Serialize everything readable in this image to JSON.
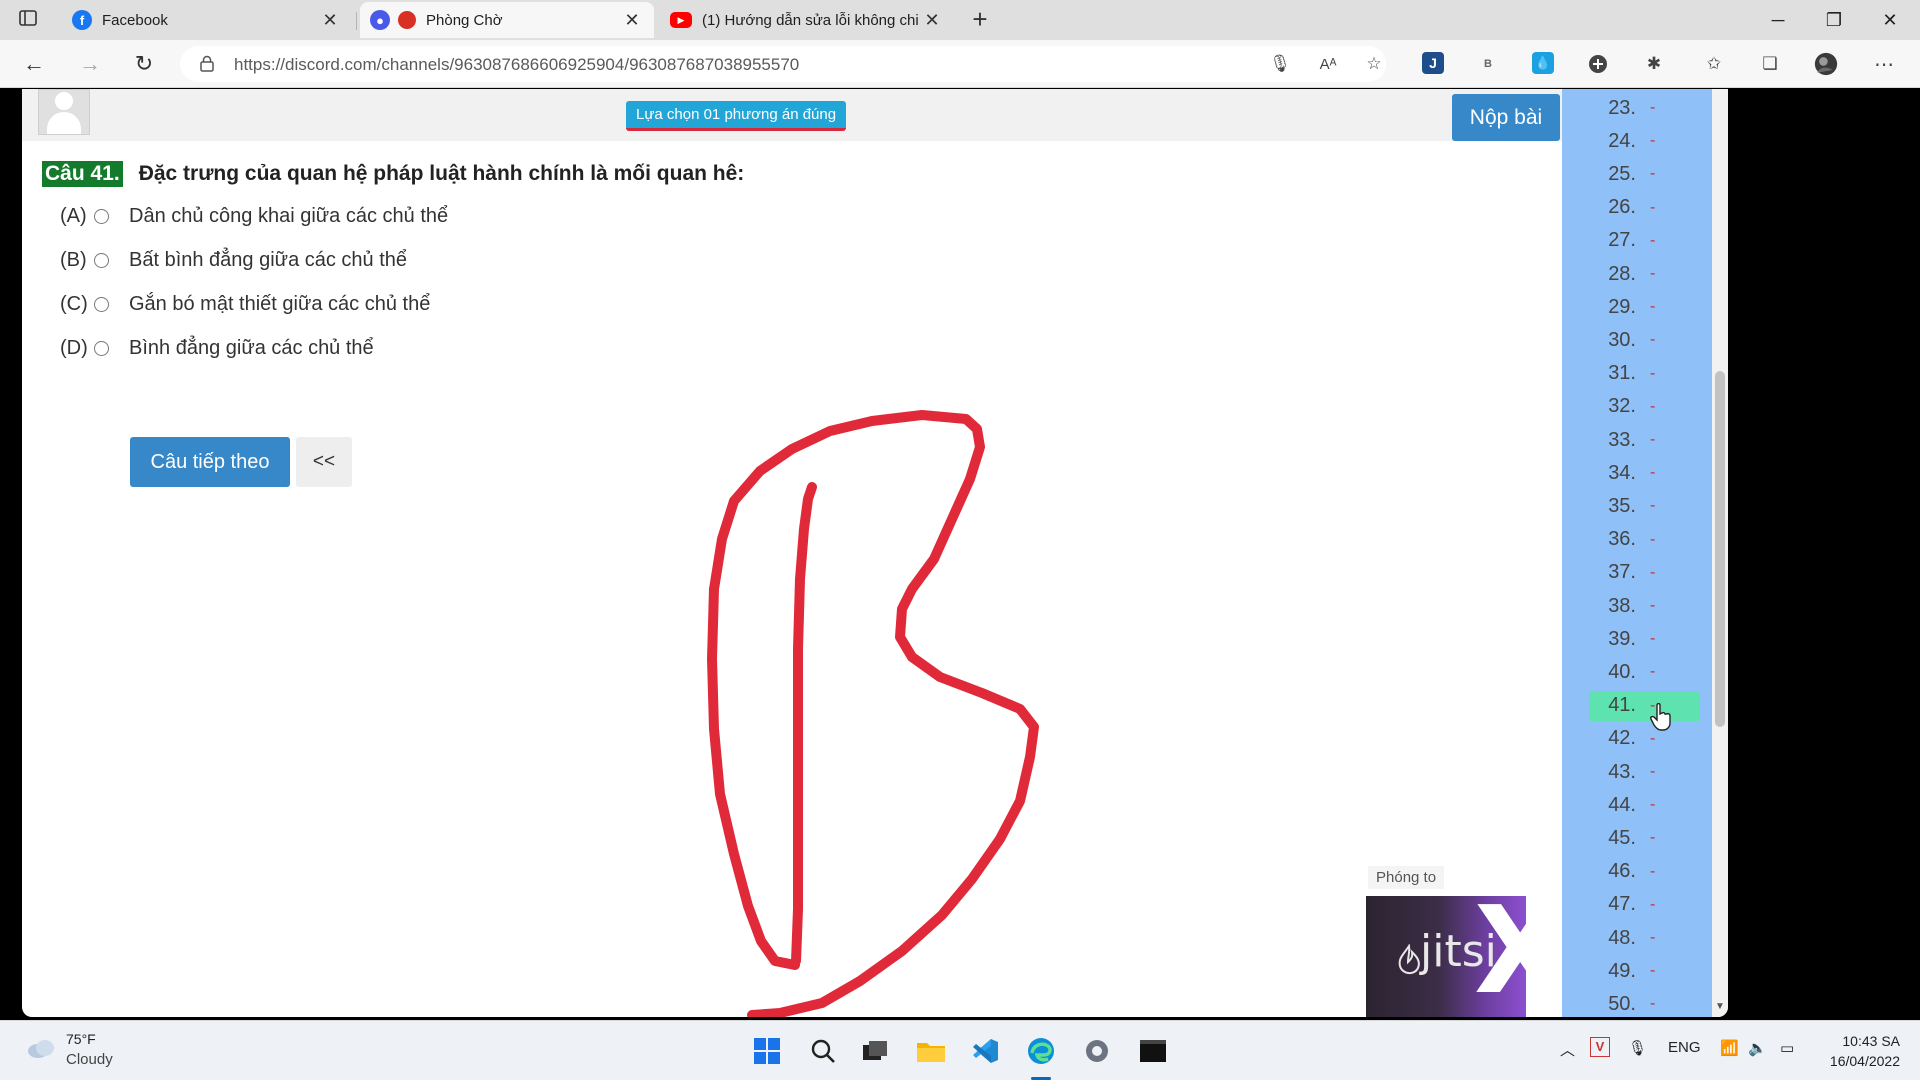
{
  "browser": {
    "tabs": [
      {
        "title": "Facebook",
        "icon": "facebook-icon",
        "color": "#1877f2",
        "active": false
      },
      {
        "title": "Phòng Chờ",
        "icon": "record-icon",
        "color": "#d93025",
        "active": true
      },
      {
        "title": "(1) Hướng dẫn sửa lỗi không chi",
        "icon": "youtube-icon",
        "color": "#ff0000",
        "active": false
      }
    ],
    "url": "https://discord.com/channels/963087686606925904/963087687038955570",
    "profile_ext_label": "B"
  },
  "exam": {
    "instruction": "Lựa chọn 01 phương án đúng",
    "submit_label": "Nộp bài",
    "question_number": "Câu 41.",
    "question_text": "Đặc trưng của quan hệ pháp luật hành chính là mối quan hê:",
    "options": [
      {
        "letter": "(A)",
        "text": "Dân chủ công khai giữa các chủ thể"
      },
      {
        "letter": "(B)",
        "text": "Bất bình đẳng giữa các chủ thể"
      },
      {
        "letter": "(C)",
        "text": "Gắn bó mật thiết giữa các chủ thể"
      },
      {
        "letter": "(D)",
        "text": "Bình đẳng giữa các chủ thể"
      }
    ],
    "next_label": "Câu tiếp theo",
    "prev_label": "<<",
    "question_list": [
      {
        "n": "23.",
        "mark": "-"
      },
      {
        "n": "24.",
        "mark": "-"
      },
      {
        "n": "25.",
        "mark": "-"
      },
      {
        "n": "26.",
        "mark": "-"
      },
      {
        "n": "27.",
        "mark": "-"
      },
      {
        "n": "28.",
        "mark": "-"
      },
      {
        "n": "29.",
        "mark": "-"
      },
      {
        "n": "30.",
        "mark": "-"
      },
      {
        "n": "31.",
        "mark": "-"
      },
      {
        "n": "32.",
        "mark": "-"
      },
      {
        "n": "33.",
        "mark": "-"
      },
      {
        "n": "34.",
        "mark": "-"
      },
      {
        "n": "35.",
        "mark": "-"
      },
      {
        "n": "36.",
        "mark": "-"
      },
      {
        "n": "37.",
        "mark": "-"
      },
      {
        "n": "38.",
        "mark": "-"
      },
      {
        "n": "39.",
        "mark": "-"
      },
      {
        "n": "40.",
        "mark": "-"
      },
      {
        "n": "41.",
        "mark": "-",
        "current": true
      },
      {
        "n": "42.",
        "mark": "-"
      },
      {
        "n": "43.",
        "mark": "-"
      },
      {
        "n": "44.",
        "mark": "-"
      },
      {
        "n": "45.",
        "mark": "-"
      },
      {
        "n": "46.",
        "mark": "-"
      },
      {
        "n": "47.",
        "mark": "-"
      },
      {
        "n": "48.",
        "mark": "-"
      },
      {
        "n": "49.",
        "mark": "-"
      },
      {
        "n": "50.",
        "mark": "-"
      }
    ]
  },
  "video": {
    "expand_label": "Phóng to",
    "brand_text": "jitsi"
  },
  "annotation": {
    "color": "#e02a3a"
  },
  "colors": {
    "accent": "#3788c8",
    "pill": "#22a6d8",
    "question_badge": "#157b2c",
    "question_list_bg": "#8fc0f7",
    "current_item": "#5ee3b0"
  },
  "taskbar": {
    "temperature": "75°F",
    "condition": "Cloudy",
    "language": "ENG",
    "time": "10:43 SA",
    "date": "16/04/2022"
  }
}
